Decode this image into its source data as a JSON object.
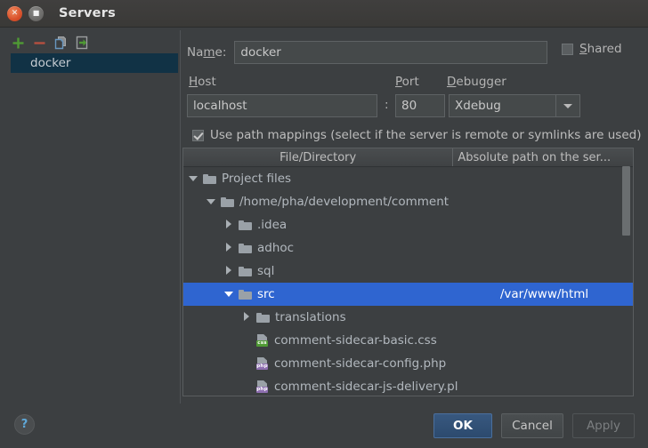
{
  "window": {
    "title": "Servers",
    "close_icon": "close-icon",
    "maximize_icon": "maximize-icon",
    "close_glyph": "✕",
    "maximize_glyph": "■"
  },
  "left_panel": {
    "toolbar": [
      {
        "name": "add-server-button",
        "icon": "plus-icon",
        "tooltip": "Add"
      },
      {
        "name": "remove-server-button",
        "icon": "minus-icon",
        "tooltip": "Remove"
      },
      {
        "name": "copy-server-button",
        "icon": "copy-icon",
        "tooltip": "Copy"
      },
      {
        "name": "import-server-button",
        "icon": "import-arrow-icon",
        "tooltip": "Import"
      }
    ],
    "items": [
      {
        "label": "docker",
        "selected": true
      }
    ]
  },
  "form": {
    "name_label": "Name:",
    "name_value": "docker",
    "shared_label": "Shared",
    "shared_checked": false,
    "host_label": "Host",
    "host_value": "localhost",
    "colon": ":",
    "port_label": "Port",
    "port_value": "80",
    "debugger_label": "Debugger",
    "debugger_value": "Xdebug",
    "debugger_options": [
      "Xdebug"
    ],
    "path_mappings_label": "Use path mappings (select if the server is remote or symlinks are used)",
    "path_mappings_checked": true
  },
  "table": {
    "headers": {
      "file_directory": "File/Directory",
      "absolute_path": "Absolute path on the ser..."
    },
    "rows": [
      {
        "label": "Project files",
        "path": "",
        "indent": 0,
        "twisty": "open",
        "icon": "folder-icon",
        "badge": "",
        "badge_color": "",
        "selected": false
      },
      {
        "label": "/home/pha/development/comment",
        "path": "",
        "indent": 1,
        "twisty": "open",
        "icon": "folder-icon",
        "badge": "",
        "badge_color": "",
        "selected": false
      },
      {
        "label": ".idea",
        "path": "",
        "indent": 2,
        "twisty": "closed",
        "icon": "folder-icon",
        "badge": "",
        "badge_color": "",
        "selected": false
      },
      {
        "label": "adhoc",
        "path": "",
        "indent": 2,
        "twisty": "closed",
        "icon": "folder-icon",
        "badge": "",
        "badge_color": "",
        "selected": false
      },
      {
        "label": "sql",
        "path": "",
        "indent": 2,
        "twisty": "closed",
        "icon": "folder-icon",
        "badge": "",
        "badge_color": "",
        "selected": false
      },
      {
        "label": "src",
        "path": "/var/www/html",
        "indent": 2,
        "twisty": "open",
        "icon": "folder-icon",
        "badge": "",
        "badge_color": "",
        "selected": true
      },
      {
        "label": "translations",
        "path": "",
        "indent": 3,
        "twisty": "closed",
        "icon": "folder-icon",
        "badge": "",
        "badge_color": "",
        "selected": false
      },
      {
        "label": "comment-sidecar-basic.css",
        "path": "",
        "indent": 3,
        "twisty": "none",
        "icon": "file-icon",
        "badge": "css",
        "badge_color": "#4f9a34",
        "selected": false
      },
      {
        "label": "comment-sidecar-config.php",
        "path": "",
        "indent": 3,
        "twisty": "none",
        "icon": "file-icon",
        "badge": "php",
        "badge_color": "#8e6fb0",
        "selected": false
      },
      {
        "label": "comment-sidecar-js-delivery.pl",
        "path": "",
        "indent": 3,
        "twisty": "none",
        "icon": "file-icon",
        "badge": "php",
        "badge_color": "#8e6fb0",
        "selected": false
      }
    ]
  },
  "footer": {
    "help_label": "?",
    "ok_label": "OK",
    "cancel_label": "Cancel",
    "apply_label": "Apply",
    "apply_enabled": false
  },
  "colors": {
    "dialog_bg": "#3c3f41",
    "selection_blue": "#2f65d0",
    "list_selection": "#113245",
    "accent_ok": "#2c4a6e",
    "close_button": "#d8502a"
  }
}
